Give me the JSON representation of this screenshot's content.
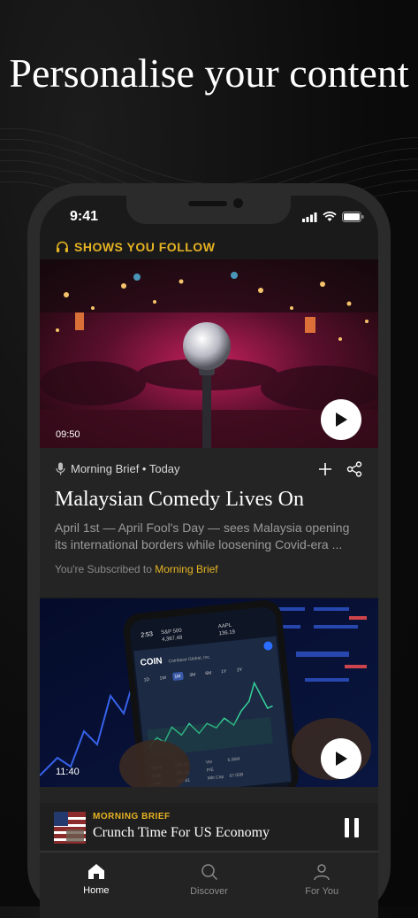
{
  "headline": "Personalise your content",
  "status": {
    "time": "9:41"
  },
  "section": {
    "title": "SHOWS YOU FOLLOW"
  },
  "episodes": [
    {
      "duration": "09:50",
      "show_meta": "Morning Brief • Today",
      "title": "Malaysian Comedy Lives On",
      "description": "April 1st — April Fool's Day — sees Malaysia opening its international borders while loosening Covid-era ...",
      "subscribed_prefix": "You're Subscribed to ",
      "subscribed_show": "Morning Brief"
    },
    {
      "duration": "11:40",
      "thumb_text": {
        "coin": "COIN",
        "company": "Coinbase Global, Inc.",
        "ticker1": "S&P 500",
        "val1": "4,387.48",
        "ticker2": "AAPL",
        "val2": "136.19"
      }
    }
  ],
  "mini_player": {
    "label": "MORNING BRIEF",
    "title": "Crunch Time For US Economy",
    "progress": 0.0
  },
  "tabs": [
    {
      "label": "Home",
      "icon": "home-icon",
      "active": true
    },
    {
      "label": "Discover",
      "icon": "search-icon",
      "active": false
    },
    {
      "label": "For You",
      "icon": "person-icon",
      "active": false
    }
  ],
  "colors": {
    "accent": "#e6b323",
    "background": "#0b0b0b",
    "card": "#242424"
  }
}
